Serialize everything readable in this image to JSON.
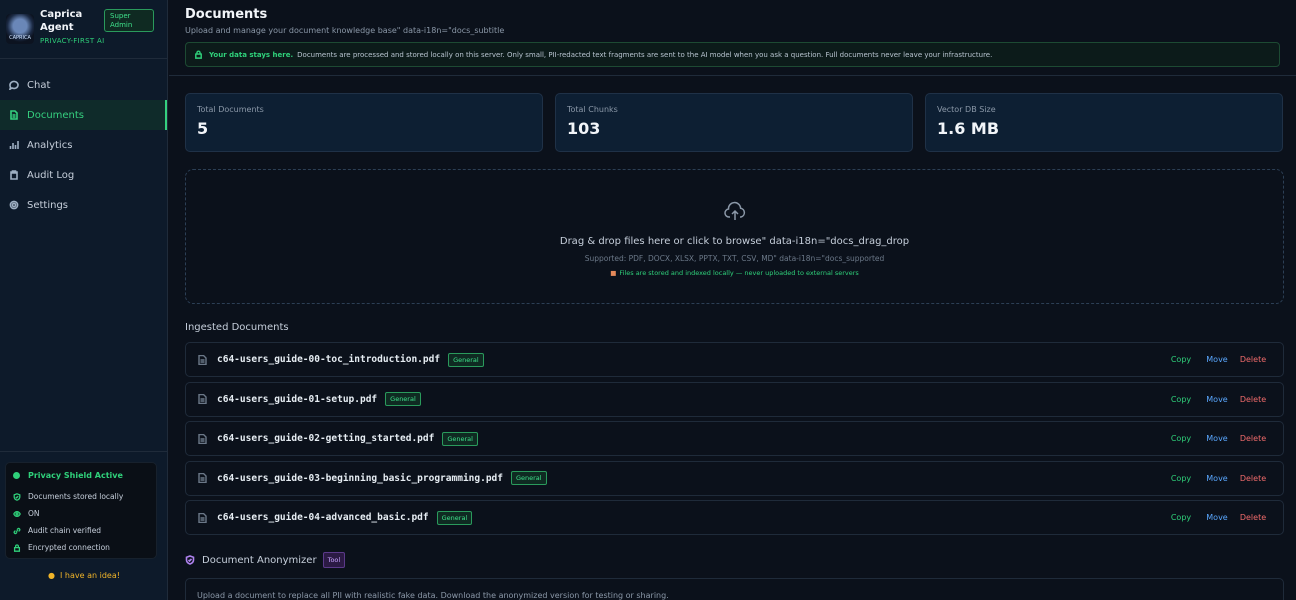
{
  "brand": {
    "name": "Caprica Agent",
    "tagline": "PRIVACY-FIRST AI",
    "role_badge": "Super Admin",
    "logo_text": "CAPRICA"
  },
  "nav": [
    {
      "label": "Chat",
      "icon": "chat-icon"
    },
    {
      "label": "Documents",
      "icon": "document-icon",
      "active": true
    },
    {
      "label": "Analytics",
      "icon": "analytics-icon"
    },
    {
      "label": "Audit Log",
      "icon": "clipboard-icon"
    },
    {
      "label": "Settings",
      "icon": "gear-icon"
    }
  ],
  "privacy": {
    "title": "Privacy Shield Active",
    "items": [
      "Documents stored locally",
      "ON",
      "Audit chain verified",
      "Encrypted connection"
    ]
  },
  "idea_label": "I have an idea!",
  "page": {
    "title": "Documents",
    "subtitle": "Upload and manage your document knowledge base\" data-i18n=\"docs_subtitle",
    "banner_strong": "Your data stays here.",
    "banner_text": "Documents are processed and stored locally on this server. Only small, PII-redacted text fragments are sent to the AI model when you ask a question. Full documents never leave your infrastructure."
  },
  "stats": [
    {
      "label": "Total Documents",
      "value": "5"
    },
    {
      "label": "Total Chunks",
      "value": "103"
    },
    {
      "label": "Vector DB Size",
      "value": "1.6 MB"
    }
  ],
  "dropzone": {
    "main": "Drag & drop files here or click to browse\" data-i18n=\"docs_drag_drop",
    "supported": "Supported: PDF, DOCX, XLSX, PPTX, TXT, CSV, MD\" data-i18n=\"docs_supported",
    "local_note": "Files are stored and indexed locally — never uploaded to external servers"
  },
  "ingested_title": "Ingested Documents",
  "documents": [
    {
      "name": "c64-users_guide-00-toc_introduction.pdf",
      "tag": "General"
    },
    {
      "name": "c64-users_guide-01-setup.pdf",
      "tag": "General"
    },
    {
      "name": "c64-users_guide-02-getting_started.pdf",
      "tag": "General"
    },
    {
      "name": "c64-users_guide-03-beginning_basic_programming.pdf",
      "tag": "General"
    },
    {
      "name": "c64-users_guide-04-advanced_basic.pdf",
      "tag": "General"
    }
  ],
  "actions": {
    "copy": "Copy",
    "move": "Move",
    "delete": "Delete"
  },
  "anonymizer": {
    "title": "Document Anonymizer",
    "badge": "Tool",
    "description": "Upload a document to replace all PII with realistic fake data. Download the anonymized version for testing or sharing."
  }
}
